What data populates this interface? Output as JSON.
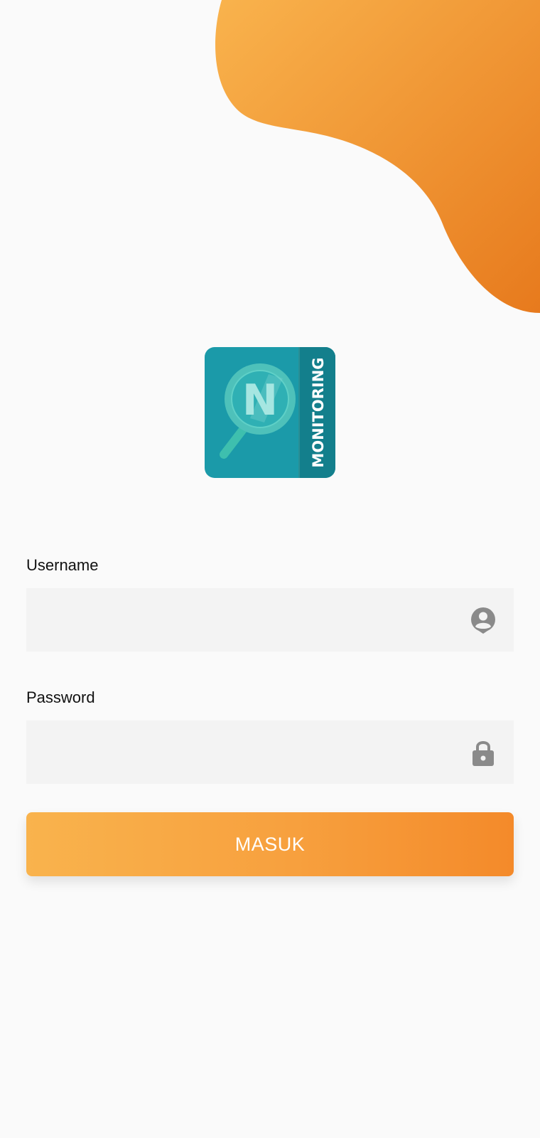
{
  "colors": {
    "background": "#fafafa",
    "blob_start": "#f9b34d",
    "blob_end": "#e77a1d",
    "logo_teal": "#1b9aa9",
    "logo_dark_teal": "#137f8c",
    "logo_lens": "#4ec1ba",
    "input_bg": "#f3f3f3",
    "icon_gray": "#8a8a8a",
    "button_start": "#f9b34d",
    "button_end": "#f48a2a",
    "button_text": "#ffffff"
  },
  "logo": {
    "text": "MONITORING",
    "letter": "N",
    "icon": "magnifier-logo-icon"
  },
  "form": {
    "username": {
      "label": "Username",
      "value": "",
      "placeholder": "",
      "icon": "user-icon"
    },
    "password": {
      "label": "Password",
      "value": "",
      "placeholder": "",
      "icon": "lock-icon"
    },
    "submit_label": "MASUK"
  }
}
